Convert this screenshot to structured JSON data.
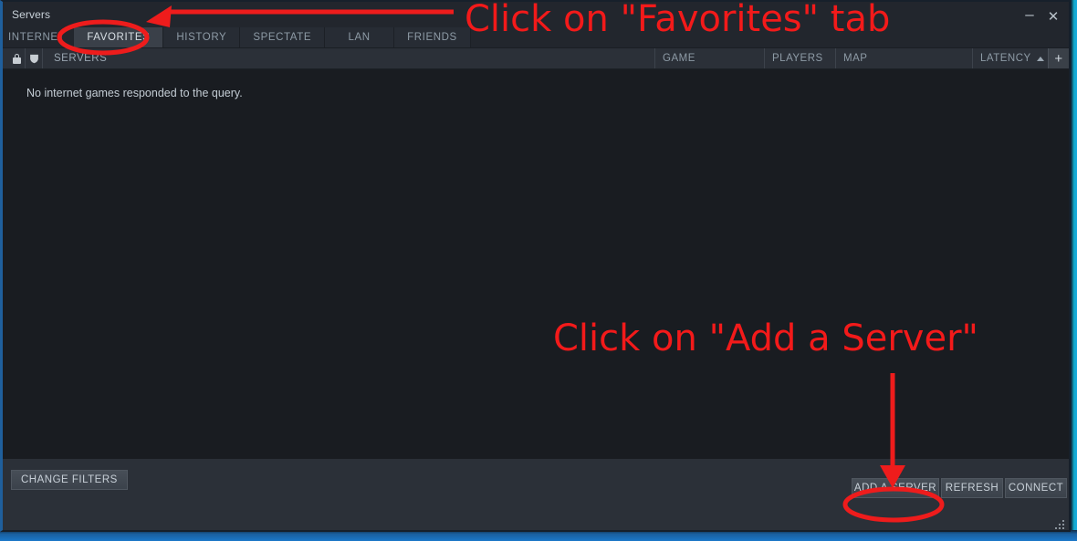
{
  "window": {
    "title": "Servers",
    "controls": [
      {
        "name": "minimize",
        "glyph": "–"
      },
      {
        "name": "close",
        "glyph": "✕"
      }
    ]
  },
  "tabs": [
    {
      "id": "internet",
      "label": "INTERNET",
      "active": false
    },
    {
      "id": "favorites",
      "label": "FAVORITES",
      "active": true
    },
    {
      "id": "history",
      "label": "HISTORY",
      "active": false
    },
    {
      "id": "spectate",
      "label": "SPECTATE",
      "active": false
    },
    {
      "id": "lan",
      "label": "LAN",
      "active": false
    },
    {
      "id": "friends",
      "label": "FRIENDS",
      "active": false
    }
  ],
  "column_headers": {
    "lock_icon": "lock-icon",
    "shield_icon": "shield-icon",
    "servers": "SERVERS",
    "game": "GAME",
    "players": "PLAYERS",
    "map": "MAP",
    "latency": "LATENCY",
    "latency_sort": "ascending",
    "add_column": "+"
  },
  "list": {
    "rows": [],
    "empty_message": "No internet games responded to the query."
  },
  "bottom_bar": {
    "change_filters": "CHANGE FILTERS",
    "add_a_server": "ADD A SERVER",
    "refresh": "REFRESH",
    "connect": "CONNECT"
  },
  "annotations": {
    "color": "#f31a1a",
    "top_text": "Click on \"Favorites\" tab",
    "bottom_text": "Click on \"Add a Server\"",
    "top_ellipse_target": "FAVORITES",
    "bottom_ellipse_target": "ADD A SERVER"
  },
  "theme": {
    "window_bg": "#23272e",
    "list_bg": "#191c21",
    "header_bg": "#2b3038",
    "tab_active_bg": "#3a4049",
    "text": "#c8d0d8",
    "muted_text": "#8e9ba6",
    "accent_blue": "#1d78c8",
    "annotation_red": "#f31a1a"
  }
}
